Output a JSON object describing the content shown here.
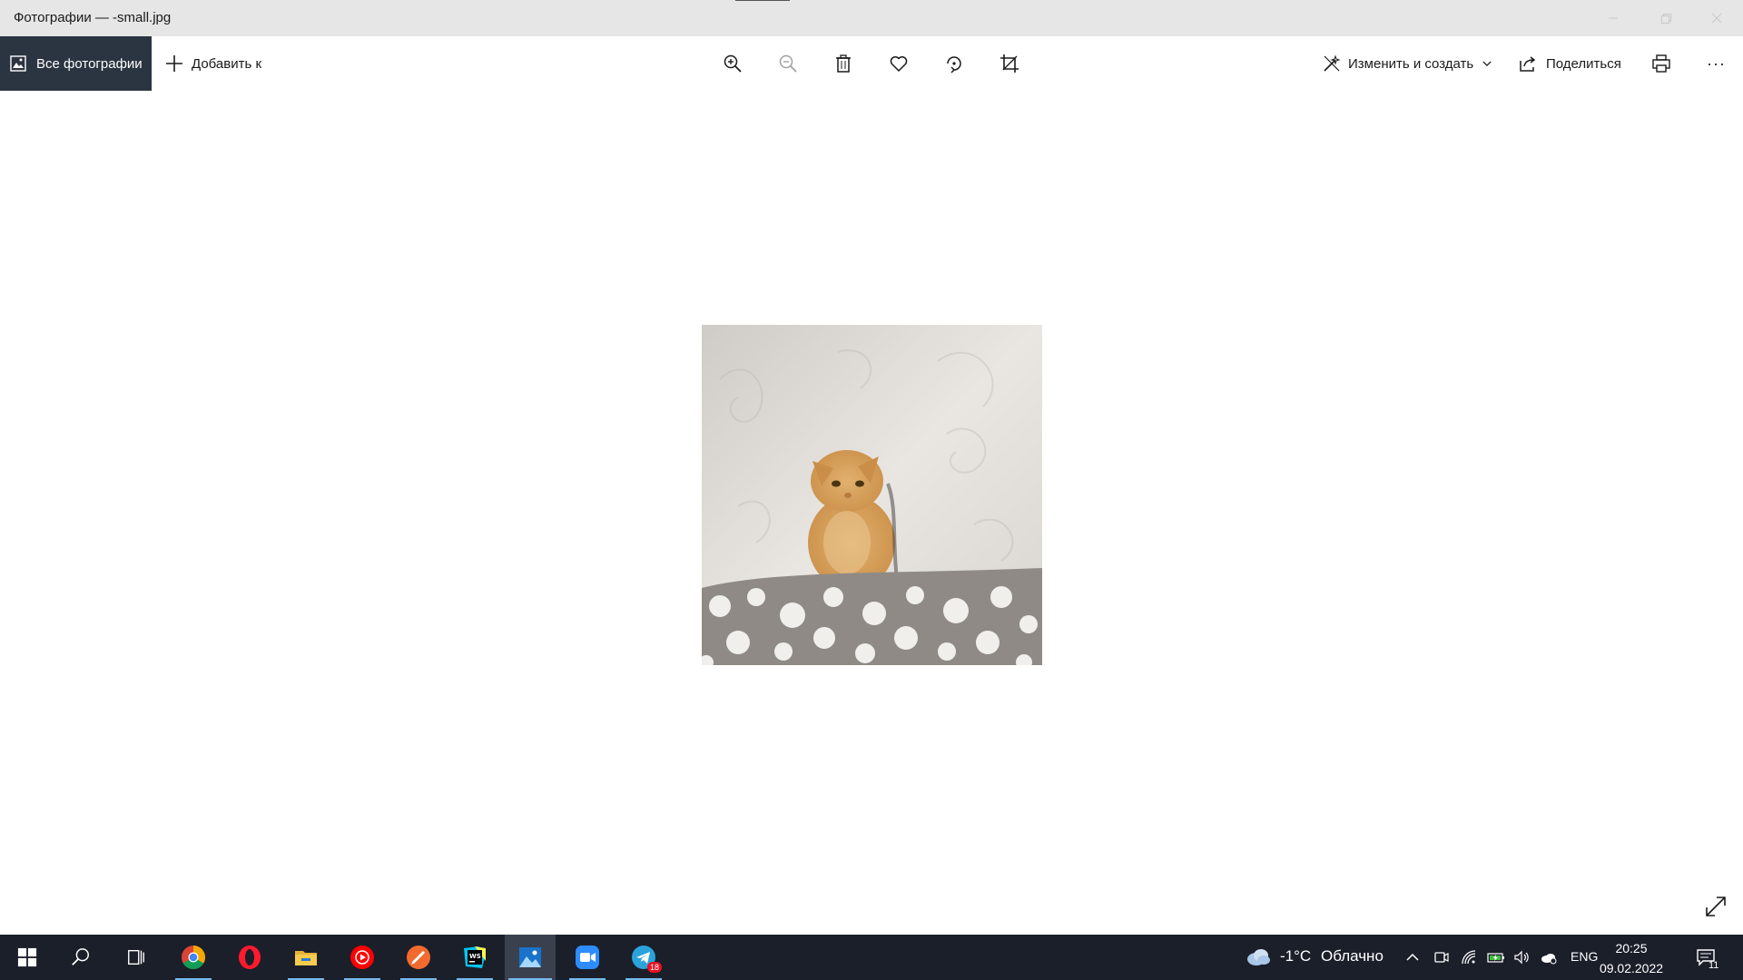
{
  "window": {
    "title": "Фотографии — -small.jpg"
  },
  "toolbar": {
    "all_photos_label": "Все фотографии",
    "add_to_label": "Добавить к",
    "edit_create_label": "Изменить и создать",
    "share_label": "Поделиться",
    "more_label": "···",
    "icons": [
      "zoom-in-icon",
      "zoom-out-icon",
      "delete-icon",
      "heart-icon",
      "rotate-icon",
      "crop-icon",
      "print-icon"
    ]
  },
  "taskbar": {
    "apps": [
      {
        "name": "start-button",
        "icon": "windows-logo-icon"
      },
      {
        "name": "search-button",
        "icon": "search-icon"
      },
      {
        "name": "task-view-button",
        "icon": "task-view-icon"
      },
      {
        "name": "chrome",
        "icon": "chrome-icon"
      },
      {
        "name": "opera",
        "icon": "opera-icon"
      },
      {
        "name": "file-explorer",
        "icon": "folder-icon"
      },
      {
        "name": "youtube-music",
        "icon": "play-circle-icon"
      },
      {
        "name": "pencil-app",
        "icon": "pencil-icon"
      },
      {
        "name": "webstorm",
        "icon": "webstorm-icon"
      },
      {
        "name": "photos",
        "icon": "photos-icon"
      },
      {
        "name": "zoom",
        "icon": "zoom-camera-icon"
      },
      {
        "name": "telegram",
        "icon": "telegram-icon"
      }
    ],
    "telegram_badge": "18",
    "weather_temp": "-1°C",
    "weather_text": "Облачно",
    "language": "ENG",
    "time": "20:25",
    "date": "09.02.2022",
    "notifications_count": "11"
  },
  "colors": {
    "titlebar_bg": "#e6e6e6",
    "all_photos_bg": "#2b3441",
    "taskbar_bg": "#1b1f2a",
    "taskbar_underline": "#76b9ed"
  }
}
